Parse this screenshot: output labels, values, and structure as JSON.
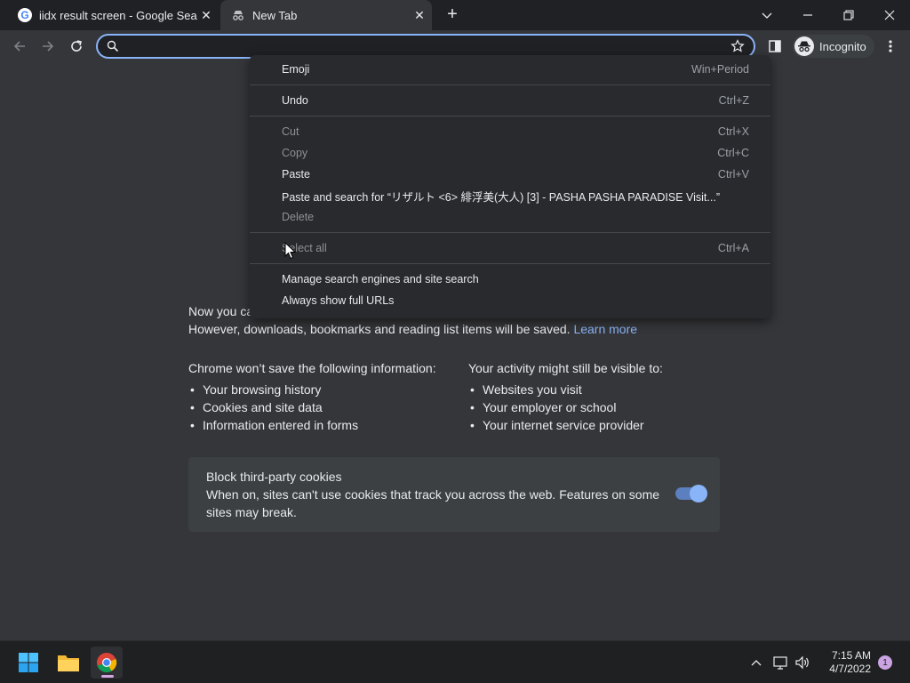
{
  "tabs": [
    {
      "title": "iidx result screen - Google Search",
      "favicon": "google-g-icon"
    },
    {
      "title": "New Tab",
      "favicon": "incognito-icon"
    }
  ],
  "omnibox": {
    "value": "",
    "placeholder": ""
  },
  "profile": {
    "label": "Incognito"
  },
  "context_menu": {
    "items": [
      {
        "label": "Emoji",
        "shortcut": "Win+Period",
        "enabled": true
      },
      {
        "separator": true
      },
      {
        "label": "Undo",
        "shortcut": "Ctrl+Z",
        "enabled": true
      },
      {
        "separator": true
      },
      {
        "label": "Cut",
        "shortcut": "Ctrl+X",
        "enabled": false
      },
      {
        "label": "Copy",
        "shortcut": "Ctrl+C",
        "enabled": false
      },
      {
        "label": "Paste",
        "shortcut": "Ctrl+V",
        "enabled": true
      },
      {
        "label": "Paste and search for “リザルト <6> 緋浮美(大人) [3] - PASHA PASHA PARADISE Visit...”",
        "shortcut": "",
        "enabled": true
      },
      {
        "label": "Delete",
        "shortcut": "",
        "enabled": false
      },
      {
        "separator": true
      },
      {
        "label": "Select all",
        "shortcut": "Ctrl+A",
        "enabled": false
      },
      {
        "separator": true
      },
      {
        "label": "Manage search engines and site search",
        "shortcut": "",
        "enabled": true
      },
      {
        "label": "Always show full URLs",
        "shortcut": "",
        "enabled": true
      }
    ]
  },
  "incognito_page": {
    "intro_line1": "Now you ca",
    "intro_line2": "However, downloads, bookmarks and reading list items will be saved.",
    "learn_more": "Learn more",
    "wont_save": {
      "heading": "Chrome won’t save the following information:",
      "items": [
        "Your browsing history",
        "Cookies and site data",
        "Information entered in forms"
      ]
    },
    "still_visible": {
      "heading": "Your activity might still be visible to:",
      "items": [
        "Websites you visit",
        "Your employer or school",
        "Your internet service provider"
      ]
    },
    "cookie_card": {
      "title": "Block third-party cookies",
      "description": "When on, sites can't use cookies that track you across the web. Features on some sites may break.",
      "toggle_on": true
    }
  },
  "taskbar": {
    "time": "7:15 AM",
    "date": "4/7/2022",
    "notification_count": "1",
    "apps": [
      "windows-start-icon",
      "file-explorer-icon",
      "chrome-icon"
    ]
  },
  "colors": {
    "accent": "#8ab4f8",
    "menu_bg": "#292a2d",
    "page_bg": "#35363a",
    "tabstrip_bg": "#202124"
  }
}
